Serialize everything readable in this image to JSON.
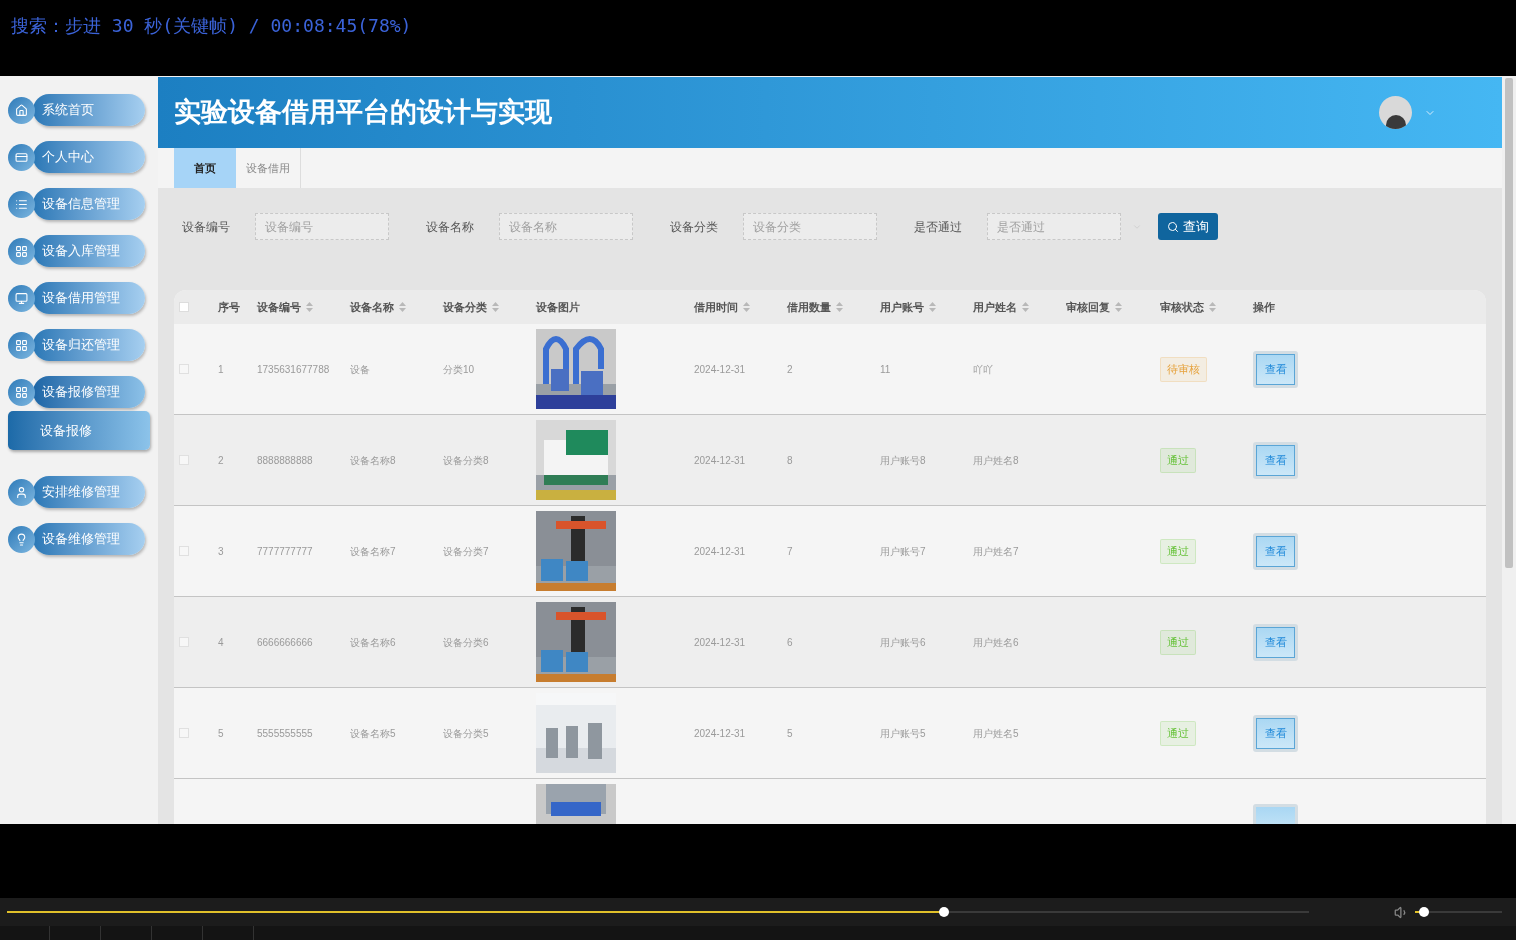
{
  "player": {
    "osd": "搜索：步进 30 秒(关键帧) / 00:08:45(78%)",
    "seek": {
      "level": 0.72
    },
    "volume": {
      "level": 0.1
    }
  },
  "app": {
    "title": "实验设备借用平台的设计与实现",
    "sidebar": {
      "items": [
        {
          "label": "系统首页",
          "expanded": false
        },
        {
          "label": "个人中心",
          "expanded": false
        },
        {
          "label": "设备信息管理",
          "expanded": false
        },
        {
          "label": "设备入库管理",
          "expanded": false
        },
        {
          "label": "设备借用管理",
          "expanded": false
        },
        {
          "label": "设备归还管理",
          "expanded": false
        },
        {
          "label": "设备报修管理",
          "expanded": true,
          "children": [
            {
              "label": "设备报修",
              "selected": true
            }
          ]
        },
        {
          "label": "安排维修管理",
          "expanded": false
        },
        {
          "label": "设备维修管理",
          "expanded": false
        }
      ]
    },
    "tabs": [
      {
        "label": "首页",
        "selected": true
      },
      {
        "label": "设备借用",
        "selected": false
      }
    ],
    "filters": [
      {
        "label": "设备编号",
        "placeholder": "设备编号",
        "kind": "text"
      },
      {
        "label": "设备名称",
        "placeholder": "设备名称",
        "kind": "text"
      },
      {
        "label": "设备分类",
        "placeholder": "设备分类",
        "kind": "text"
      },
      {
        "label": "是否通过",
        "placeholder": "是否通过",
        "kind": "select"
      }
    ],
    "search_button": "查询",
    "table": {
      "select_all": {
        "checked": false
      },
      "columns": [
        {
          "label": "序号",
          "sortable": false
        },
        {
          "label": "设备编号",
          "sortable": true
        },
        {
          "label": "设备名称",
          "sortable": true
        },
        {
          "label": "设备分类",
          "sortable": true
        },
        {
          "label": "设备图片",
          "sortable": false
        },
        {
          "label": "借用时间",
          "sortable": true
        },
        {
          "label": "借用数量",
          "sortable": true
        },
        {
          "label": "用户账号",
          "sortable": true
        },
        {
          "label": "用户姓名",
          "sortable": true
        },
        {
          "label": "审核回复",
          "sortable": true
        },
        {
          "label": "审核状态",
          "sortable": true
        },
        {
          "label": "操作",
          "sortable": false
        }
      ],
      "rows": [
        {
          "index": "1",
          "code": "1735631677788",
          "name": "设备",
          "category": "分类10",
          "time": "2024-12-31",
          "qty": "2",
          "account": "11",
          "user": "吖吖",
          "status": "待审核",
          "color": "#e6a23c",
          "checked": false,
          "action": "查看"
        },
        {
          "index": "2",
          "code": "8888888888",
          "name": "设备名称8",
          "category": "设备分类8",
          "time": "2024-12-31",
          "qty": "8",
          "account": "用户账号8",
          "user": "用户姓名8",
          "status": "通过",
          "color": "#67c23a",
          "checked": false,
          "action": "查看"
        },
        {
          "index": "3",
          "code": "7777777777",
          "name": "设备名称7",
          "category": "设备分类7",
          "time": "2024-12-31",
          "qty": "7",
          "account": "用户账号7",
          "user": "用户姓名7",
          "status": "通过",
          "color": "#67c23a",
          "checked": false,
          "action": "查看"
        },
        {
          "index": "4",
          "code": "6666666666",
          "name": "设备名称6",
          "category": "设备分类6",
          "time": "2024-12-31",
          "qty": "6",
          "account": "用户账号6",
          "user": "用户姓名6",
          "status": "通过",
          "color": "#67c23a",
          "checked": false,
          "action": "查看"
        },
        {
          "index": "5",
          "code": "5555555555",
          "name": "设备名称5",
          "category": "设备分类5",
          "time": "2024-12-31",
          "qty": "5",
          "account": "用户账号5",
          "user": "用户姓名5",
          "status": "通过",
          "color": "#67c23a",
          "checked": false,
          "action": "查看"
        }
      ]
    }
  }
}
